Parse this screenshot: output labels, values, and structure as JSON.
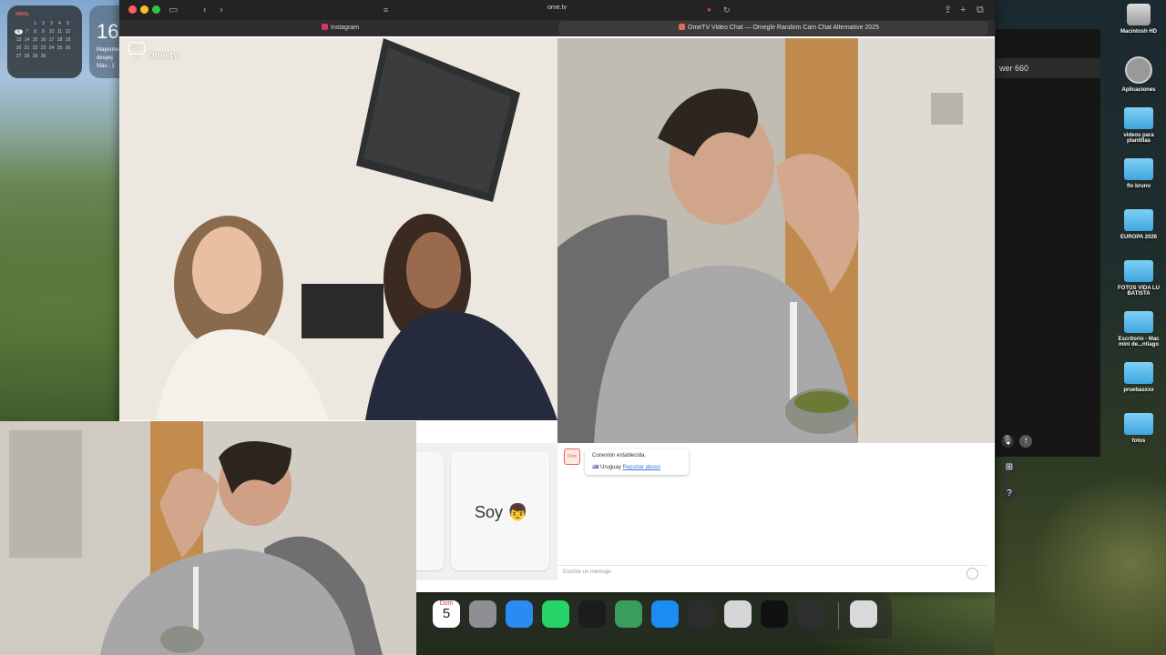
{
  "desktop": {
    "calendar_widget": {
      "month": "ABRIL",
      "days": [
        "",
        "",
        "1",
        "2",
        "3",
        "4",
        "5",
        "6",
        "7",
        "8",
        "9",
        "10",
        "11",
        "12",
        "13",
        "14",
        "15",
        "16",
        "17",
        "18",
        "19",
        "20",
        "21",
        "22",
        "23",
        "24",
        "25",
        "26",
        "27",
        "28",
        "29",
        "30",
        "",
        "",
        ""
      ],
      "today": "6"
    },
    "weather_widget": {
      "temp": "16",
      "line1": "Mayorme",
      "line2": "despej",
      "line3": "Máx.: 1"
    },
    "icons": [
      {
        "label": "Macintosh HD",
        "type": "disk"
      },
      {
        "label": "Aplicaciones",
        "type": "apps"
      },
      {
        "label": "videos para plantillas",
        "type": "folder"
      },
      {
        "label": "flo bruno",
        "type": "folder"
      },
      {
        "label": "EUROPA 2026",
        "type": "folder"
      },
      {
        "label": "FOTOS VIDA LU BATISTA",
        "type": "folder"
      },
      {
        "label": "Escritorio - Mac mini de...ntiago",
        "type": "folder"
      },
      {
        "label": "pruebasxxx",
        "type": "folder"
      },
      {
        "label": "fotos",
        "type": "folder"
      }
    ],
    "bg_app_title": "wer 660"
  },
  "browser": {
    "url": "ome.tv",
    "tabs": [
      {
        "label": "Instagram",
        "color": "#d6336c"
      },
      {
        "label": "OmeTV Video Chat — Omegle Random Cam Chat Alternative 2025",
        "color": "#e06a5a"
      }
    ]
  },
  "ometv": {
    "logo": "Ome.tv",
    "logo_box": "Ome TV",
    "chat": {
      "message_line1": "Conexión establecida.",
      "country": "Uruguay",
      "report": "Reportar abuso",
      "placeholder": "Escribe un mensaje"
    },
    "cards": [
      {
        "label": "Soy 👦"
      }
    ]
  },
  "dock": {
    "calendar_month": "Dom",
    "calendar_day": "5",
    "apps": [
      {
        "name": "calendar",
        "color": "#ffffff"
      },
      {
        "name": "system-settings",
        "color": "#8e8e93"
      },
      {
        "name": "safari",
        "color": "#2a8bf2"
      },
      {
        "name": "whatsapp",
        "color": "#25d366"
      },
      {
        "name": "tradingview",
        "color": "#1c1c1c"
      },
      {
        "name": "money-app",
        "color": "#3a9d5d"
      },
      {
        "name": "app-store",
        "color": "#1b8cf2"
      },
      {
        "name": "final-cut-pro",
        "color": "#2c2c2c"
      },
      {
        "name": "compressor",
        "color": "#d6d6d6"
      },
      {
        "name": "logitech-g-hub",
        "color": "#111111"
      },
      {
        "name": "obs-studio",
        "color": "#2f2f2f"
      },
      {
        "name": "trash",
        "color": "#d9d9d9"
      }
    ]
  }
}
